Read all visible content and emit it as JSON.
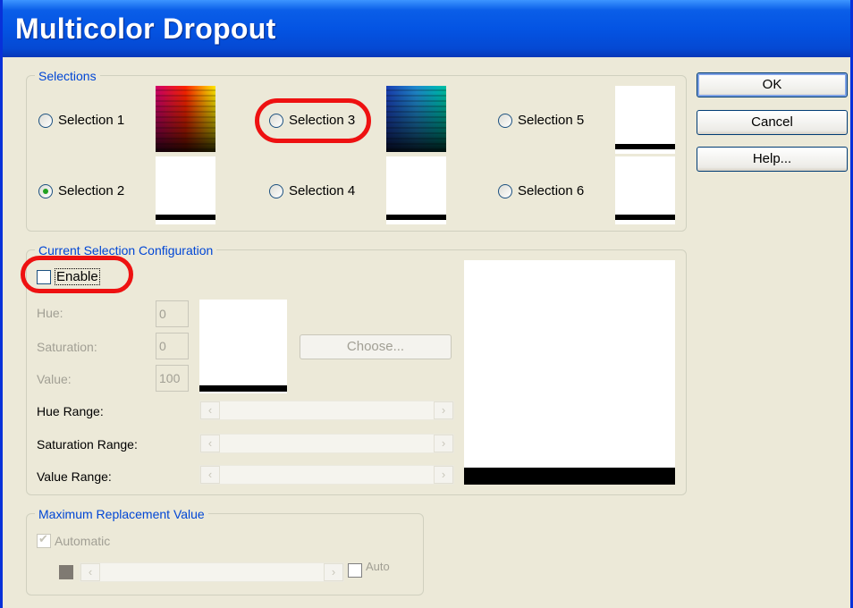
{
  "window": {
    "title": "Multicolor Dropout"
  },
  "buttons": {
    "ok": "OK",
    "cancel": "Cancel",
    "help": "Help..."
  },
  "selections": {
    "group_label": "Selections",
    "items": [
      {
        "label": "Selection 1",
        "selected": false
      },
      {
        "label": "Selection 2",
        "selected": true
      },
      {
        "label": "Selection 3",
        "selected": false
      },
      {
        "label": "Selection 4",
        "selected": false
      },
      {
        "label": "Selection 5",
        "selected": false
      },
      {
        "label": "Selection 6",
        "selected": false
      }
    ]
  },
  "current": {
    "group_label": "Current Selection Configuration",
    "enable_label": "Enable",
    "enabled": false,
    "hue_label": "Hue:",
    "hue_value": "0",
    "saturation_label": "Saturation:",
    "saturation_value": "0",
    "value_label": "Value:",
    "value_value": "100",
    "choose_label": "Choose...",
    "hue_range_label": "Hue Range:",
    "saturation_range_label": "Saturation Range:",
    "value_range_label": "Value Range:"
  },
  "max_replacement": {
    "group_label": "Maximum Replacement Value",
    "automatic_label": "Automatic",
    "automatic_checked": true,
    "auto_label": "Auto"
  },
  "icons": {
    "scroll_left": "left-arrow-icon",
    "scroll_right": "right-arrow-icon"
  },
  "colors": {
    "title_bar": "#0454e3",
    "dialog_bg": "#ece9d8",
    "annotation": "#ee1111",
    "group_label": "#0046d5"
  }
}
